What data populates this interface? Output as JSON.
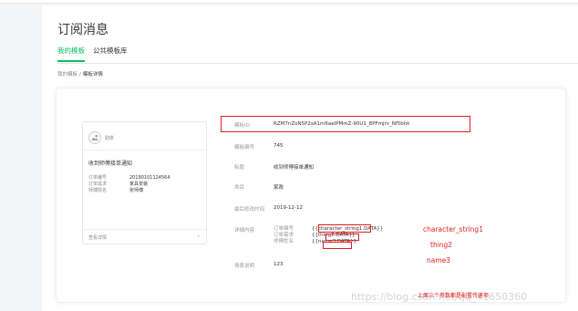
{
  "page": {
    "title": "订阅消息",
    "tabs": [
      {
        "label": "我的模板",
        "active": true
      },
      {
        "label": "公共模板库",
        "active": false
      }
    ],
    "breadcrumb": {
      "parent": "我的模板",
      "separator": "/",
      "current": "模板详情"
    }
  },
  "card": {
    "brand": "助拼",
    "icon": "mountain-sun-icon",
    "title": "收到师傅接单通知",
    "rows": [
      {
        "key": "订单编号",
        "value": "20190101124564"
      },
      {
        "key": "订单需求",
        "value": "家具安装"
      },
      {
        "key": "师傅姓名",
        "value": "张师傅"
      }
    ],
    "footer": "查看详情",
    "footer_icon": "chevron-right-icon"
  },
  "detail": {
    "id_label": "模板ID",
    "id_value": "RZM7nZoN5P2sA1m6aeIPMmZ-90U1_8PFmjrv_Nf5bhk",
    "no_label": "模板编号",
    "no_value": "745",
    "title_label": "标题",
    "title_value": "收到师傅接单通知",
    "cat_label": "类目",
    "cat_value": "家政",
    "time_label": "最后修改时间",
    "time_value": "2019-12-12",
    "detail_label": "详细内容",
    "detail_rows": [
      {
        "key": "订单编号",
        "value": "{{character_string1.DATA}}"
      },
      {
        "key": "订单需求",
        "value": "{{thing2.DATA}}"
      },
      {
        "key": "师傅姓名",
        "value": "{{name3.DATA}}"
      }
    ],
    "scene_label": "场景说明",
    "scene_value": "123"
  },
  "annotations": {
    "n1": "character_string1",
    "n2": "thing2",
    "n3": "name3",
    "n4": "上面三个参数都是配置传递项"
  },
  "watermark": "https://blog.csdn.net/qq_41650360",
  "colors": {
    "accent": "#07c160",
    "annotation": "#e0201e"
  }
}
